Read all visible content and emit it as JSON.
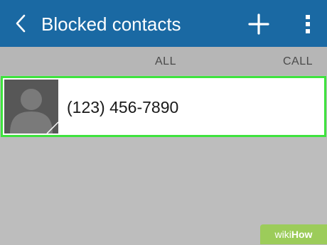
{
  "app_bar": {
    "title": "Blocked contacts",
    "back_icon": "chevron-left-icon",
    "add_icon": "plus-icon",
    "more_icon": "more-vert-icon",
    "background_color": "#1a69a3"
  },
  "filter_bar": {
    "all_label": "ALL",
    "call_label": "CALL"
  },
  "contacts": [
    {
      "phone_number": "(123) 456-7890",
      "avatar_icon": "person-placeholder-icon",
      "highlight_color": "#3ee33e"
    }
  ],
  "watermark": {
    "prefix": "wiki",
    "suffix": "How"
  }
}
